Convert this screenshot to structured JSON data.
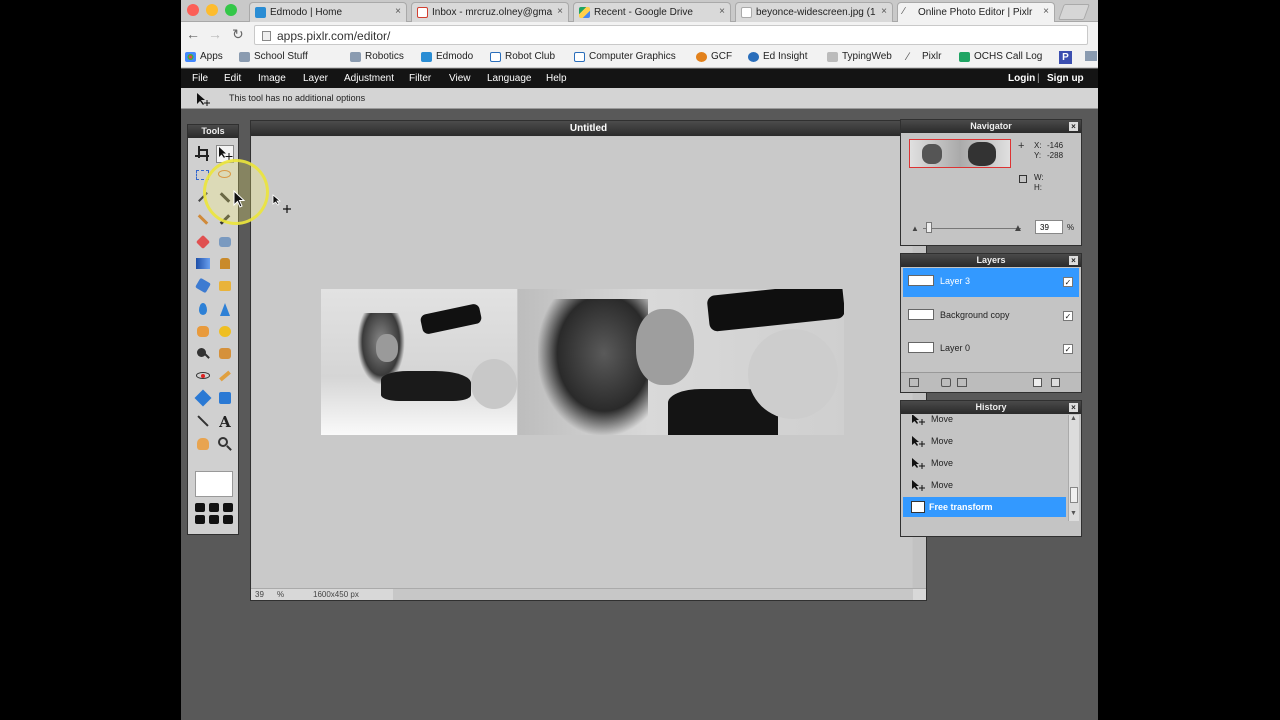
{
  "browser": {
    "tabs": [
      {
        "label": "Edmodo | Home",
        "icon": "edmodo-icon",
        "color": "#2a8dd4"
      },
      {
        "label": "Inbox - mrcruz.olney@gma",
        "icon": "gmail-icon",
        "color": "#d23f31"
      },
      {
        "label": "Recent - Google Drive",
        "icon": "drive-icon",
        "color": "#1fa463"
      },
      {
        "label": "beyonce-widescreen.jpg (1",
        "icon": "file-icon",
        "color": "#aaaaaa"
      },
      {
        "label": "Online Photo Editor | Pixlr",
        "icon": "pixlr-icon",
        "color": "#6aa84f"
      }
    ],
    "tab_close": "×",
    "url": "apps.pixlr.com/editor/",
    "bookmarks": [
      {
        "label": "Apps",
        "icon": "apps-grid-icon"
      },
      {
        "label": "School Stuff",
        "icon": "folder-icon"
      },
      {
        "label": "Robotics",
        "icon": "folder-icon"
      },
      {
        "label": "Edmodo",
        "icon": "edmodo-icon"
      },
      {
        "label": "Robot Club",
        "icon": "page-icon"
      },
      {
        "label": "Computer Graphics",
        "icon": "page-icon"
      },
      {
        "label": "GCF",
        "icon": "gcf-icon"
      },
      {
        "label": "Ed Insight",
        "icon": "globe-icon"
      },
      {
        "label": "TypingWeb",
        "icon": "typing-icon"
      },
      {
        "label": "Pixlr",
        "icon": "pen-icon"
      },
      {
        "label": "OCHS Call Log",
        "icon": "sheet-icon"
      },
      {
        "label": "P",
        "icon": "p-icon"
      }
    ]
  },
  "app": {
    "menu": [
      "File",
      "Edit",
      "Image",
      "Layer",
      "Adjustment",
      "Filter",
      "View",
      "Language",
      "Help"
    ],
    "login": "Login",
    "separator": "|",
    "signup": "Sign up",
    "tool_options": "This tool has no additional options",
    "tools_title": "Tools",
    "document": {
      "title": "Untitled",
      "zoom": "39",
      "zoom_unit": "%",
      "size": "1600x450 px"
    },
    "navigator": {
      "title": "Navigator",
      "x_label": "X:",
      "x_value": "-146",
      "y_label": "Y:",
      "y_value": "-288",
      "w_label": "W:",
      "h_label": "H:",
      "zoom": "39",
      "zoom_unit": "%"
    },
    "layers": {
      "title": "Layers",
      "items": [
        {
          "label": "Layer 3",
          "checked": "✓"
        },
        {
          "label": "Background copy",
          "checked": "✓"
        },
        {
          "label": "Layer 0",
          "checked": "✓"
        }
      ]
    },
    "history": {
      "title": "History",
      "items": [
        "Move",
        "Move",
        "Move",
        "Move",
        "Free transform"
      ]
    }
  }
}
